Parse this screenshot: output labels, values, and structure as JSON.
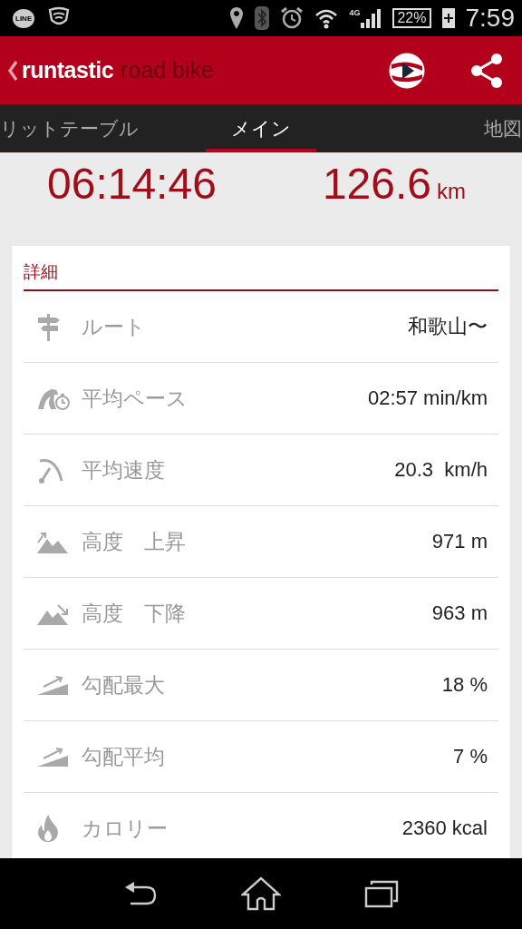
{
  "status_bar": {
    "left_badge": "LINE",
    "network": "4G",
    "battery": "22%",
    "time": "7:59"
  },
  "app_bar": {
    "logo_primary": "runtastic",
    "logo_secondary": "road bike"
  },
  "tabs": [
    {
      "label": "リットテーブル",
      "selected": false
    },
    {
      "label": "メイン",
      "selected": true
    },
    {
      "label": "地図",
      "selected": false
    }
  ],
  "summary": {
    "duration": "06:14:46",
    "distance": "126.6",
    "distance_unit": "km"
  },
  "details": {
    "title": "詳細",
    "rows": [
      {
        "kind": "route",
        "label": "ルート",
        "value": "和歌山〜"
      },
      {
        "kind": "pace",
        "label": "平均ペース",
        "value": "02:57 min/km"
      },
      {
        "kind": "speed",
        "label": "平均速度",
        "value": "20.3  km/h"
      },
      {
        "kind": "ascent",
        "label": "高度　上昇",
        "value": "971 m"
      },
      {
        "kind": "descent",
        "label": "高度　下降",
        "value": "963 m"
      },
      {
        "kind": "grade_max",
        "label": "勾配最大",
        "value": "18 %"
      },
      {
        "kind": "grade_avg",
        "label": "勾配平均",
        "value": "7 %"
      },
      {
        "kind": "calories",
        "label": "カロリー",
        "value": "2360 kcal"
      }
    ]
  }
}
